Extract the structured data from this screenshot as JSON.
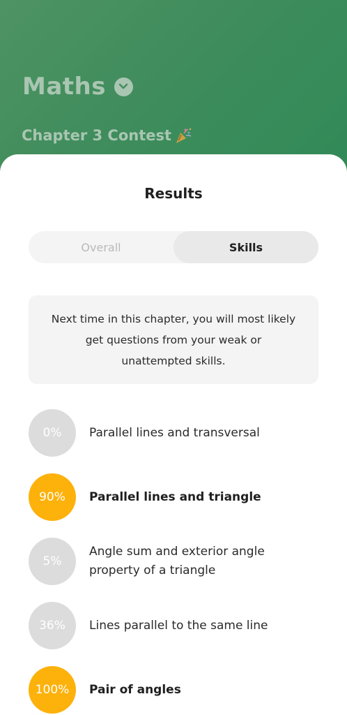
{
  "header": {
    "subject": "Maths",
    "contest": "Chapter 3 Contest",
    "contest_icon": "party-popper-icon",
    "colors": {
      "gradient_start": "#4e9363",
      "gradient_end": "#2f8a57",
      "header_text": "#a9c6b2"
    }
  },
  "sheet": {
    "title": "Results",
    "tabs": [
      {
        "label": "Overall",
        "active": false
      },
      {
        "label": "Skills",
        "active": true
      }
    ],
    "info": "Next time in this chapter, you will most likely get questions from your weak or unattempted skills."
  },
  "skills": [
    {
      "percent": "0%",
      "label": "Parallel lines and transversal",
      "status": "weak"
    },
    {
      "percent": "90%",
      "label": "Parallel lines and triangle",
      "status": "strong"
    },
    {
      "percent": "5%",
      "label": "Angle sum and exterior angle property of a triangle",
      "status": "weak"
    },
    {
      "percent": "36%",
      "label": "Lines parallel to the same line",
      "status": "weak"
    },
    {
      "percent": "100%",
      "label": "Pair of angles",
      "status": "strong"
    }
  ],
  "colors": {
    "strong": "#fdb10b",
    "weak": "#dcdcdc"
  }
}
